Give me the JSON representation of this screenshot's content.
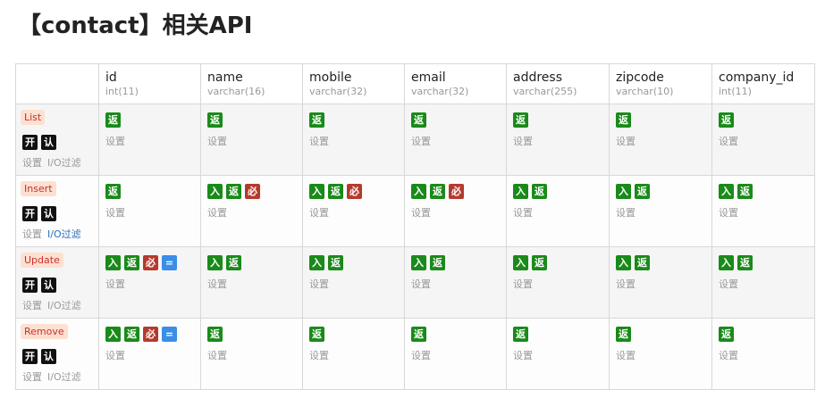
{
  "page": {
    "title": "【contact】相关API"
  },
  "table": {
    "columns": [
      {
        "name": "id",
        "type": "int(11)"
      },
      {
        "name": "name",
        "type": "varchar(16)"
      },
      {
        "name": "mobile",
        "type": "varchar(32)"
      },
      {
        "name": "email",
        "type": "varchar(32)"
      },
      {
        "name": "address",
        "type": "varchar(255)"
      },
      {
        "name": "zipcode",
        "type": "varchar(10)"
      },
      {
        "name": "company_id",
        "type": "int(11)"
      }
    ],
    "badge_labels": {
      "in": "入",
      "ret": "返",
      "req": "必",
      "eq": "=",
      "open": "开",
      "auth": "认"
    },
    "setting_label": "设置",
    "io_filter_label": "I/O过滤",
    "rows": [
      {
        "op": "List",
        "cells": [
          [
            "ret"
          ],
          [
            "ret"
          ],
          [
            "ret"
          ],
          [
            "ret"
          ],
          [
            "ret"
          ],
          [
            "ret"
          ],
          [
            "ret"
          ]
        ]
      },
      {
        "op": "Insert",
        "cells": [
          [
            "ret"
          ],
          [
            "in",
            "ret",
            "req"
          ],
          [
            "in",
            "ret",
            "req"
          ],
          [
            "in",
            "ret",
            "req"
          ],
          [
            "in",
            "ret"
          ],
          [
            "in",
            "ret"
          ],
          [
            "in",
            "ret"
          ]
        ]
      },
      {
        "op": "Update",
        "cells": [
          [
            "in",
            "ret",
            "req",
            "eq"
          ],
          [
            "in",
            "ret"
          ],
          [
            "in",
            "ret"
          ],
          [
            "in",
            "ret"
          ],
          [
            "in",
            "ret"
          ],
          [
            "in",
            "ret"
          ],
          [
            "in",
            "ret"
          ]
        ]
      },
      {
        "op": "Remove",
        "cells": [
          [
            "in",
            "ret",
            "req",
            "eq"
          ],
          [
            "ret"
          ],
          [
            "ret"
          ],
          [
            "ret"
          ],
          [
            "ret"
          ],
          [
            "ret"
          ],
          [
            "ret"
          ]
        ]
      }
    ]
  }
}
